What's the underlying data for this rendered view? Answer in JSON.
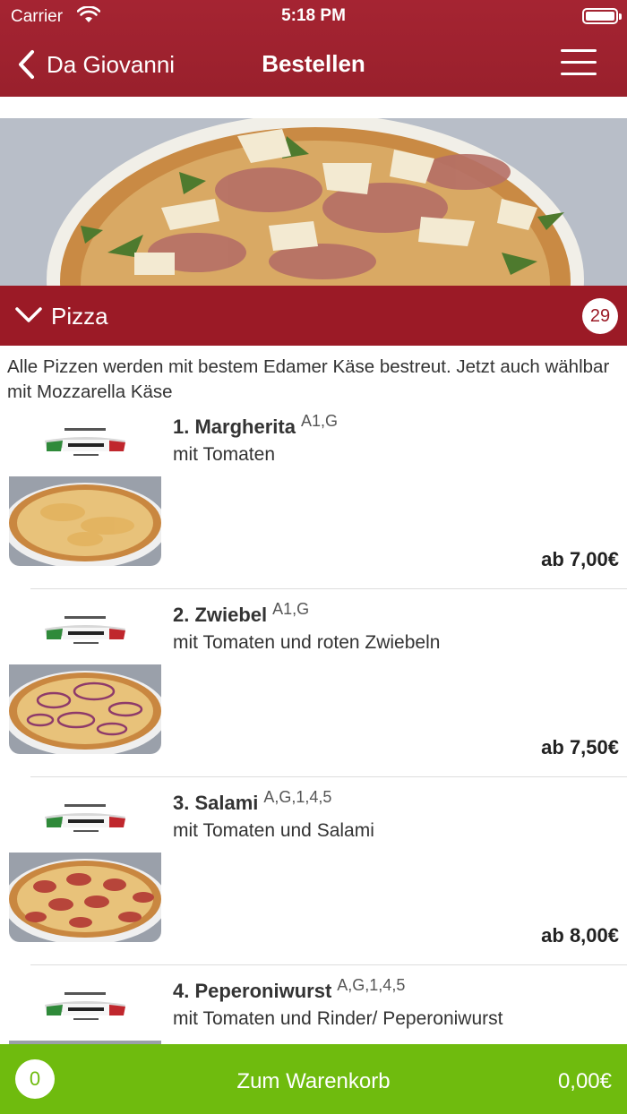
{
  "status": {
    "carrier": "Carrier",
    "time": "5:18 PM"
  },
  "nav": {
    "back_label": "Da Giovanni",
    "title": "Bestellen"
  },
  "category": {
    "name": "Pizza",
    "count": "29",
    "description": "Alle Pizzen werden mit bestem Edamer Käse bestreut. Jetzt auch wählbar mit Mozzarella Käse"
  },
  "items": [
    {
      "name": "1. Margherita",
      "allergens": "A1,G",
      "description": "mit Tomaten",
      "price": "ab 7,00€",
      "topping": "cheese"
    },
    {
      "name": "2. Zwiebel",
      "allergens": "A1,G",
      "description": "mit Tomaten und roten Zwiebeln",
      "price": "ab 7,50€",
      "topping": "onion"
    },
    {
      "name": "3. Salami",
      "allergens": "A,G,1,4,5",
      "description": "mit Tomaten und Salami",
      "price": "ab 8,00€",
      "topping": "salami"
    },
    {
      "name": "4. Peperoniwurst",
      "allergens": "A,G,1,4,5",
      "description": "mit Tomaten und Rinder/ Peperoniwurst",
      "price": "",
      "topping": "pepperoni"
    }
  ],
  "cart": {
    "count": "0",
    "label": "Zum Warenkorb",
    "total": "0,00€"
  },
  "colors": {
    "brand_red": "#9b1a26",
    "cart_green": "#6fbb0e"
  }
}
